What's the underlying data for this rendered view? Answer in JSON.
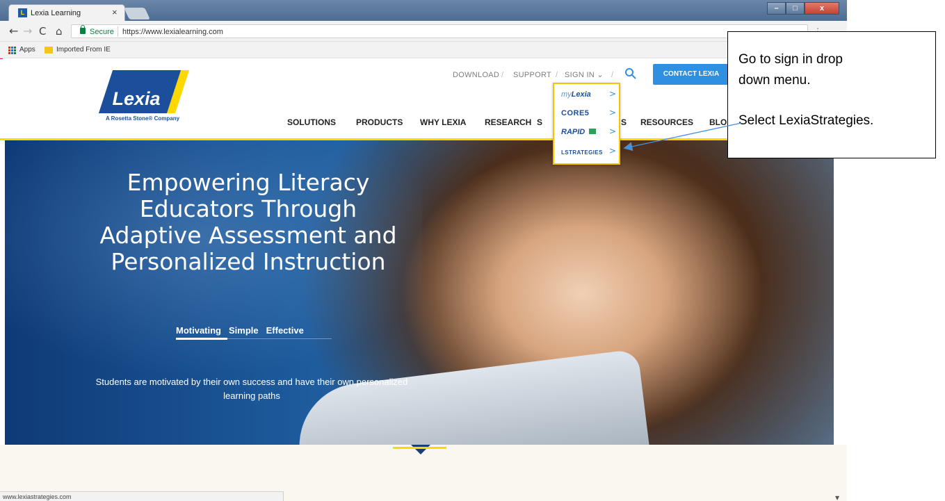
{
  "browser": {
    "tab_title": "Lexia Learning",
    "tab_close": "×",
    "tab_favicon_letter": "L",
    "secure_label": "Secure",
    "url": "https://www.lexialearning.com",
    "bookmarks": [
      "Apps",
      "Imported From IE"
    ],
    "status_url": "www.lexiastrategies.com",
    "window_controls": [
      "–",
      "□",
      "x"
    ],
    "nav_icons": {
      "back": "←",
      "forward": "→",
      "reload": "C",
      "home": "⌂",
      "menu": "⋮"
    }
  },
  "site": {
    "logo": {
      "word": "Lexia",
      "tagline": "A Rosetta Stone® Company"
    },
    "utility_nav": [
      {
        "label": "DOWNLOAD"
      },
      {
        "label": "SUPPORT"
      },
      {
        "label": "SIGN IN ⌄"
      }
    ],
    "utility_separator": "/",
    "contact_button": "CONTACT LEXIA",
    "main_nav": [
      "SOLUTIONS",
      "PRODUCTS",
      "WHY LEXIA",
      "RESEARCH",
      "S",
      "S",
      "RESOURCES",
      "BLO"
    ],
    "signin_menu": [
      {
        "label_prefix": "my",
        "label_main": "Lexia",
        "chevron": ">"
      },
      {
        "label": "CORE5",
        "chevron": ">"
      },
      {
        "label": "RAPID",
        "chevron": ">"
      },
      {
        "label": "LSTRATEGIES",
        "chevron": ">"
      }
    ],
    "hero": {
      "title_lines": [
        "Empowering Literacy",
        "Educators Through",
        "Adaptive Assessment and",
        "Personalized Instruction"
      ],
      "tabs": [
        "Motivating",
        "Simple",
        "Effective"
      ],
      "active_tab": "Motivating",
      "description": "Students are motivated by their own success and have their own personalized learning paths"
    }
  },
  "callout": {
    "lines": [
      "Go to sign in drop",
      "down menu.",
      "Select LexiaStrategies."
    ]
  },
  "colors": {
    "brand_blue": "#1b4f9c",
    "brand_yellow": "#ffd800",
    "contact_blue": "#2f8fe0",
    "arrow_blue": "#4a90d9"
  }
}
